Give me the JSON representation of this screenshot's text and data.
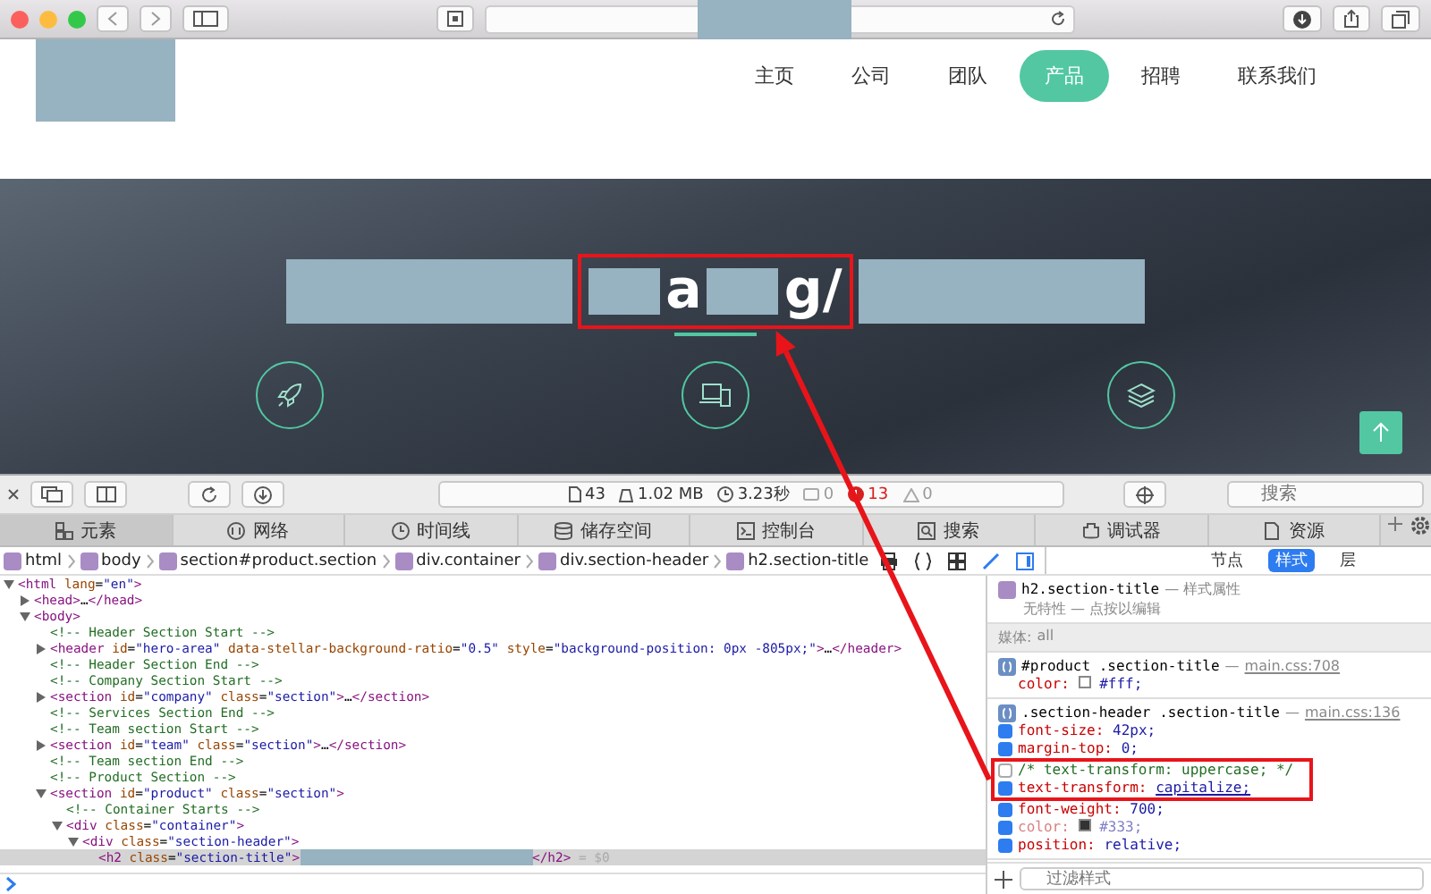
{
  "site": {
    "nav": [
      {
        "label": "主页",
        "selected": false
      },
      {
        "label": "公司",
        "selected": false
      },
      {
        "label": "团队",
        "selected": false
      },
      {
        "label": "产品",
        "selected": true
      },
      {
        "label": "招聘",
        "selected": false
      },
      {
        "label": "联系我们",
        "selected": false
      }
    ]
  },
  "hero": {
    "title": [
      {
        "kind": "redacted",
        "highlighted": false
      },
      {
        "kind": "redacted-small",
        "highlighted": true
      },
      {
        "kind": "text",
        "text": "a",
        "highlighted": true
      },
      {
        "kind": "redacted-small",
        "highlighted": true
      },
      {
        "kind": "text",
        "text": "g/",
        "highlighted": true
      },
      {
        "kind": "redacted",
        "highlighted": false
      }
    ]
  },
  "devtools": {
    "toolbar": {
      "resources": "43",
      "size": "1.02 MB",
      "time": "3.23秒",
      "messages": "0",
      "errors": "13",
      "warnings": "0",
      "search_placeholder": "搜索"
    },
    "tabs": [
      {
        "label": "元素",
        "selected": true
      },
      {
        "label": "网络",
        "selected": false
      },
      {
        "label": "时间线",
        "selected": false
      },
      {
        "label": "储存空间",
        "selected": false
      },
      {
        "label": "控制台",
        "selected": false
      },
      {
        "label": "搜索",
        "selected": false
      },
      {
        "label": "调试器",
        "selected": false
      },
      {
        "label": "资源",
        "selected": false
      }
    ],
    "breadcrumb": [
      "html",
      "body",
      "section#product.section",
      "div.container",
      "div.section-header",
      "h2.section-title"
    ],
    "sidebar_modes": [
      {
        "label": "节点",
        "selected": false
      },
      {
        "label": "样式",
        "selected": true
      },
      {
        "label": "层",
        "selected": false
      }
    ],
    "dom": [
      {
        "kind": "element",
        "expanded": true,
        "selected": false,
        "code": [
          {
            "kind": "tag",
            "text": "<html"
          },
          {
            "kind": "attr",
            "text": " lang"
          },
          {
            "kind": "plain",
            "text": "="
          },
          {
            "kind": "value",
            "text": "\"en\""
          },
          {
            "kind": "tag",
            "text": ">"
          }
        ],
        "children": [
          {
            "kind": "element",
            "expanded": false,
            "selected": false,
            "code": [
              {
                "kind": "tag",
                "text": "<head>"
              },
              {
                "kind": "plain",
                "text": "…"
              },
              {
                "kind": "tag",
                "text": "</head>"
              }
            ]
          },
          {
            "kind": "element",
            "expanded": true,
            "selected": false,
            "code": [
              {
                "kind": "tag",
                "text": "<body>"
              }
            ],
            "children": [
              {
                "kind": "comment",
                "selected": false,
                "code": [
                  {
                    "kind": "comment",
                    "text": "<!-- Header Section Start -->"
                  }
                ]
              },
              {
                "kind": "element",
                "expanded": false,
                "selected": false,
                "code": [
                  {
                    "kind": "tag",
                    "text": "<header"
                  },
                  {
                    "kind": "attr",
                    "text": " id"
                  },
                  {
                    "kind": "plain",
                    "text": "="
                  },
                  {
                    "kind": "value",
                    "text": "\"hero-area\""
                  },
                  {
                    "kind": "attr",
                    "text": " data-stellar-background-ratio"
                  },
                  {
                    "kind": "plain",
                    "text": "="
                  },
                  {
                    "kind": "value",
                    "text": "\"0.5\""
                  },
                  {
                    "kind": "attr",
                    "text": " style"
                  },
                  {
                    "kind": "plain",
                    "text": "="
                  },
                  {
                    "kind": "value",
                    "text": "\"background-position: 0px -805px;\""
                  },
                  {
                    "kind": "tag",
                    "text": ">"
                  },
                  {
                    "kind": "plain",
                    "text": "…"
                  },
                  {
                    "kind": "tag",
                    "text": "</header>"
                  }
                ]
              },
              {
                "kind": "comment",
                "selected": false,
                "code": [
                  {
                    "kind": "comment",
                    "text": "<!-- Header Section End -->"
                  }
                ]
              },
              {
                "kind": "comment",
                "selected": false,
                "code": [
                  {
                    "kind": "comment",
                    "text": "<!-- Company Section Start -->"
                  }
                ]
              },
              {
                "kind": "element",
                "expanded": false,
                "selected": false,
                "code": [
                  {
                    "kind": "tag",
                    "text": "<section"
                  },
                  {
                    "kind": "attr",
                    "text": " id"
                  },
                  {
                    "kind": "plain",
                    "text": "="
                  },
                  {
                    "kind": "value",
                    "text": "\"company\""
                  },
                  {
                    "kind": "attr",
                    "text": " class"
                  },
                  {
                    "kind": "plain",
                    "text": "="
                  },
                  {
                    "kind": "value",
                    "text": "\"section\""
                  },
                  {
                    "kind": "tag",
                    "text": ">"
                  },
                  {
                    "kind": "plain",
                    "text": "…"
                  },
                  {
                    "kind": "tag",
                    "text": "</section>"
                  }
                ]
              },
              {
                "kind": "comment",
                "selected": false,
                "code": [
                  {
                    "kind": "comment",
                    "text": "<!-- Services Section End -->"
                  }
                ]
              },
              {
                "kind": "comment",
                "selected": false,
                "code": [
                  {
                    "kind": "comment",
                    "text": "<!-- Team section Start -->"
                  }
                ]
              },
              {
                "kind": "element",
                "expanded": false,
                "selected": false,
                "code": [
                  {
                    "kind": "tag",
                    "text": "<section"
                  },
                  {
                    "kind": "attr",
                    "text": " id"
                  },
                  {
                    "kind": "plain",
                    "text": "="
                  },
                  {
                    "kind": "value",
                    "text": "\"team\""
                  },
                  {
                    "kind": "attr",
                    "text": " class"
                  },
                  {
                    "kind": "plain",
                    "text": "="
                  },
                  {
                    "kind": "value",
                    "text": "\"section\""
                  },
                  {
                    "kind": "tag",
                    "text": ">"
                  },
                  {
                    "kind": "plain",
                    "text": "…"
                  },
                  {
                    "kind": "tag",
                    "text": "</section>"
                  }
                ]
              },
              {
                "kind": "comment",
                "selected": false,
                "code": [
                  {
                    "kind": "comment",
                    "text": "<!-- Team section End -->"
                  }
                ]
              },
              {
                "kind": "comment",
                "selected": false,
                "code": [
                  {
                    "kind": "comment",
                    "text": "<!-- Product Section -->"
                  }
                ]
              },
              {
                "kind": "element",
                "expanded": true,
                "selected": false,
                "code": [
                  {
                    "kind": "tag",
                    "text": "<section"
                  },
                  {
                    "kind": "attr",
                    "text": " id"
                  },
                  {
                    "kind": "plain",
                    "text": "="
                  },
                  {
                    "kind": "value",
                    "text": "\"product\""
                  },
                  {
                    "kind": "attr",
                    "text": " class"
                  },
                  {
                    "kind": "plain",
                    "text": "="
                  },
                  {
                    "kind": "value",
                    "text": "\"section\""
                  },
                  {
                    "kind": "tag",
                    "text": ">"
                  }
                ],
                "children": [
                  {
                    "kind": "comment",
                    "selected": false,
                    "code": [
                      {
                        "kind": "comment",
                        "text": "<!-- Container Starts -->"
                      }
                    ]
                  },
                  {
                    "kind": "element",
                    "expanded": true,
                    "selected": false,
                    "code": [
                      {
                        "kind": "tag",
                        "text": "<div"
                      },
                      {
                        "kind": "attr",
                        "text": " class"
                      },
                      {
                        "kind": "plain",
                        "text": "="
                      },
                      {
                        "kind": "value",
                        "text": "\"container\""
                      },
                      {
                        "kind": "tag",
                        "text": ">"
                      }
                    ],
                    "children": [
                      {
                        "kind": "element",
                        "expanded": true,
                        "selected": false,
                        "code": [
                          {
                            "kind": "tag",
                            "text": "<div"
                          },
                          {
                            "kind": "attr",
                            "text": " class"
                          },
                          {
                            "kind": "plain",
                            "text": "="
                          },
                          {
                            "kind": "value",
                            "text": "\"section-header\""
                          },
                          {
                            "kind": "tag",
                            "text": ">"
                          }
                        ],
                        "children": [
                          {
                            "kind": "leaf",
                            "selected": true,
                            "redacted": true,
                            "code": [
                              {
                                "kind": "tag",
                                "text": "<h2"
                              },
                              {
                                "kind": "attr",
                                "text": " class"
                              },
                              {
                                "kind": "plain",
                                "text": "="
                              },
                              {
                                "kind": "value",
                                "text": "\"section-title\""
                              },
                              {
                                "kind": "tag",
                                "text": ">"
                              }
                            ],
                            "code_after": [
                              {
                                "kind": "tag",
                                "text": "</h2>"
                              },
                              {
                                "kind": "dim",
                                "text": " = $0"
                              }
                            ]
                          }
                        ]
                      }
                    ]
                  }
                ]
              }
            ]
          }
        ]
      }
    ],
    "styles": {
      "element_rule": {
        "selector": "h2.section-title",
        "origin": "— 样式属性",
        "note": "无特性 — 点按以编辑"
      },
      "media": {
        "label": "媒体:",
        "value": "all"
      },
      "rules": [
        {
          "selector": "#product .section-title",
          "separator": "—",
          "source": "main.css:708",
          "props": [
            {
              "kind": "plain",
              "name": "color:",
              "value": "#fff;",
              "swatch": true
            }
          ]
        },
        {
          "selector": ".section-header .section-title",
          "separator": "—",
          "source": "main.css:136",
          "props": [
            {
              "kind": "checkbox",
              "name": "font-size:",
              "value": "42px;",
              "checked": true,
              "overridden": false,
              "highlighted": false
            },
            {
              "kind": "checkbox",
              "name": "margin-top:",
              "value": "0;",
              "checked": true,
              "overridden": false,
              "highlighted": false
            },
            {
              "kind": "comment",
              "text": "/* text-transform: uppercase; */",
              "checked": false,
              "highlighted": true
            },
            {
              "kind": "checkbox",
              "name": "text-transform:",
              "value": "capitalize;",
              "link": true,
              "checked": true,
              "overridden": false,
              "highlighted": true
            },
            {
              "kind": "checkbox",
              "name": "font-weight:",
              "value": "700;",
              "checked": true,
              "overridden": false,
              "highlighted": false
            },
            {
              "kind": "checkbox",
              "name": "color:",
              "value": "#333;",
              "swatch": true,
              "checked": true,
              "overridden": true,
              "highlighted": false
            },
            {
              "kind": "checkbox",
              "name": "position:",
              "value": "relative;",
              "checked": true,
              "overridden": false,
              "highlighted": false
            }
          ]
        }
      ],
      "filter_placeholder": "过滤样式"
    }
  }
}
